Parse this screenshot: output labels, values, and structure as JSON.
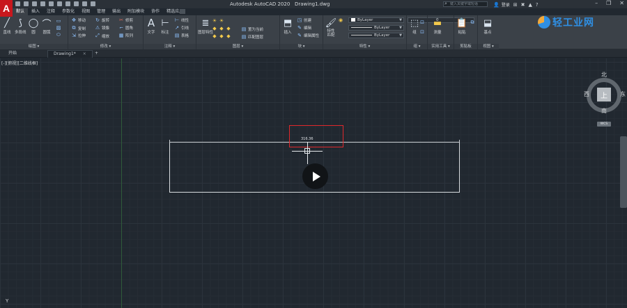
{
  "app": {
    "logo": "A",
    "title": "Autodesk AutoCAD 2020",
    "file": "Drawing1.dwg",
    "search_placeholder": "键入关键字或短语",
    "login": "登录"
  },
  "ribbon_tabs": [
    "默认",
    "插入",
    "注释",
    "参数化",
    "视图",
    "管理",
    "输出",
    "附加模块",
    "协作",
    "精选应用"
  ],
  "ribbon": {
    "draw": {
      "title": "绘图 ▾",
      "line": "直线",
      "polyline": "多段线",
      "circle": "圆",
      "arc": "圆弧"
    },
    "modify": {
      "title": "修改 ▾",
      "move": "移动",
      "rotate": "旋转",
      "trim": "修剪",
      "copy": "复制",
      "mirror": "镜像",
      "fillet": "圆角",
      "stretch": "拉伸",
      "scale": "缩放",
      "array": "阵列"
    },
    "annotation": {
      "title": "注释 ▾",
      "text": "文字",
      "dimension": "标注",
      "linear": "线性",
      "leader": "引线",
      "table": "表格"
    },
    "layers": {
      "title": "图层 ▾",
      "layer_props": "图层特性",
      "current_layer": "0",
      "make_current": "置为当前",
      "match_layer": "匹配图层"
    },
    "block": {
      "title": "块 ▾",
      "insert": "插入",
      "create": "创建",
      "edit": "编辑",
      "edit_attr": "编辑属性"
    },
    "properties": {
      "title": "特性 ▾",
      "match": "特性匹配",
      "color": "ByLayer",
      "linetype": "ByLayer",
      "lineweight": "ByLayer"
    },
    "groups": {
      "title": "组 ▾",
      "group": "组"
    },
    "utilities": {
      "title": "实用工具 ▾",
      "measure": "测量"
    },
    "clipboard": {
      "title": "剪贴板",
      "paste": "粘贴"
    },
    "view": {
      "title": "视图 ▾",
      "base": "基点"
    }
  },
  "doc_tabs": [
    {
      "label": "开始"
    },
    {
      "label": "Drawing1*",
      "close": "×"
    }
  ],
  "canvas": {
    "viewport_label": "[-][俯视][二维线框]",
    "dimension_value": "316.36"
  },
  "viewcube": {
    "north": "北",
    "south": "南",
    "east": "东",
    "west": "西",
    "face": "上",
    "wcs": "WCS"
  },
  "watermark": "轻工业网",
  "colors": {
    "accent": "#c8171d",
    "highlight": "#e0282c",
    "canvas": "#212830"
  }
}
